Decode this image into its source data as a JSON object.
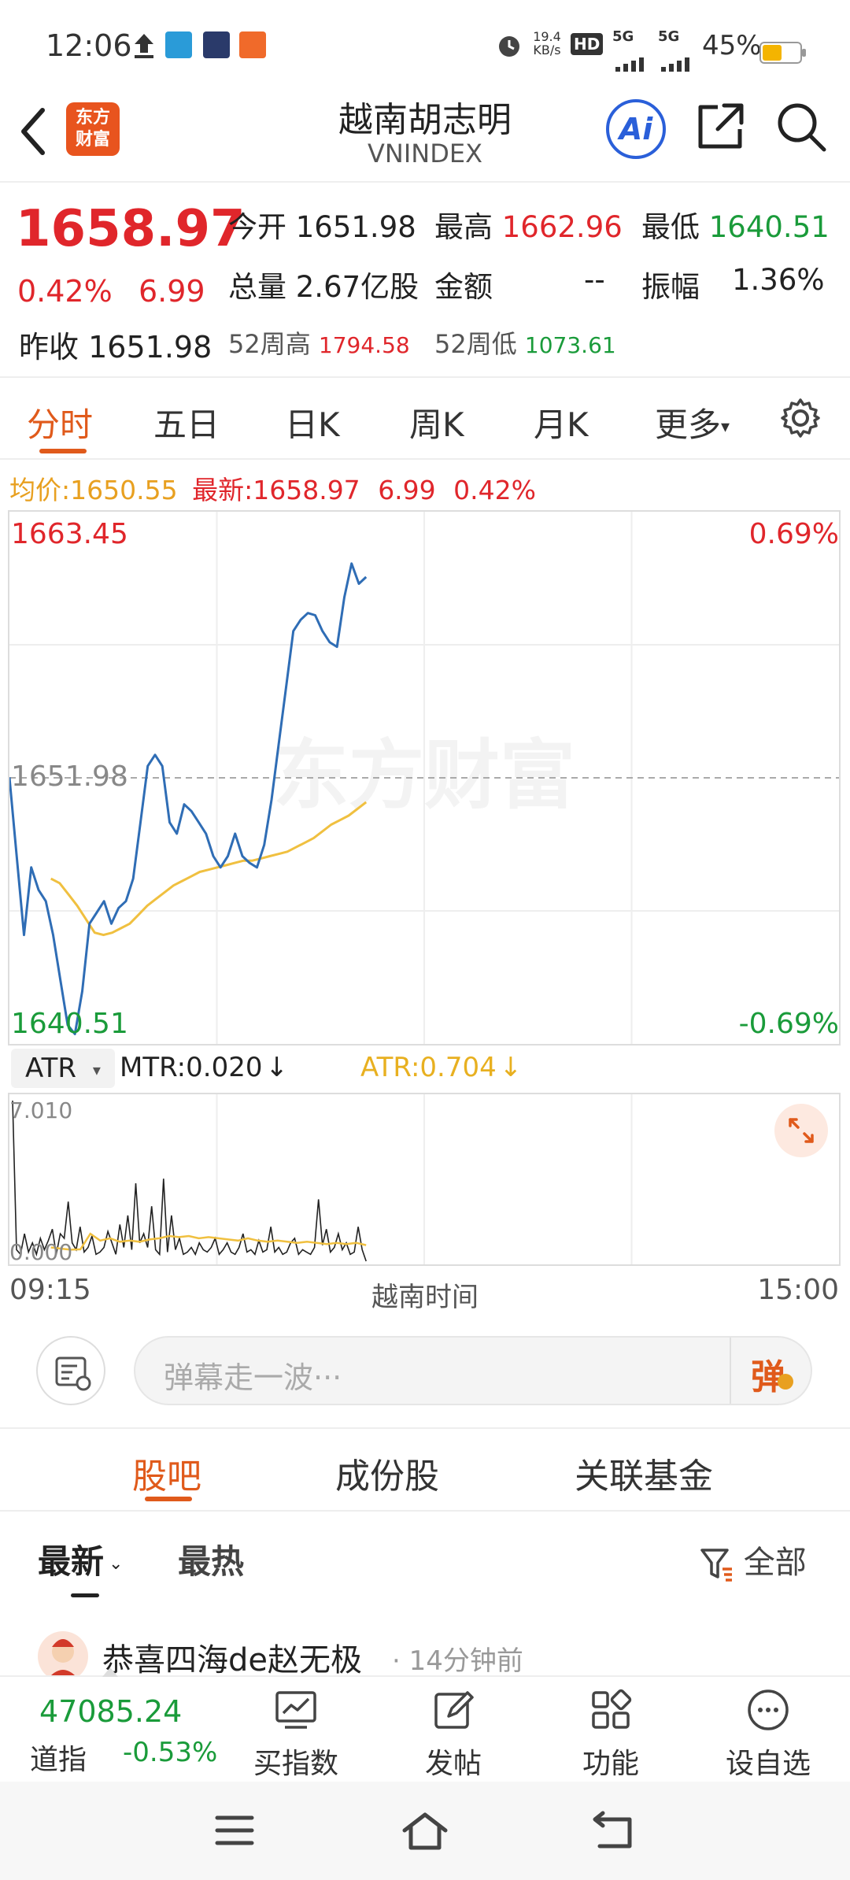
{
  "status": {
    "time": "12:06",
    "net_speed_value": "19.4",
    "net_speed_unit": "KB/s",
    "battery": "45%",
    "signal_1": "5G",
    "signal_2": "5G",
    "hd": "HD"
  },
  "nav": {
    "logo_line1": "东方",
    "logo_line2": "财富",
    "title": "越南胡志明",
    "subtitle": "VNINDEX",
    "ai_label": "Ai"
  },
  "quote": {
    "price": "1658.97",
    "change_pct": "0.42%",
    "change": "6.99",
    "prev_close_label": "昨收",
    "prev_close": "1651.98",
    "open_label": "今开",
    "open": "1651.98",
    "high_label": "最高",
    "high": "1662.96",
    "low_label": "最低",
    "low": "1640.51",
    "volume_label": "总量",
    "volume": "2.67亿股",
    "amount_label": "金额",
    "amount": "--",
    "amplitude_label": "振幅",
    "amplitude": "1.36%",
    "week52_high_label": "52周高",
    "week52_high": "1794.58",
    "week52_low_label": "52周低",
    "week52_low": "1073.61"
  },
  "tabs": [
    "分时",
    "五日",
    "日K",
    "周K",
    "月K",
    "更多"
  ],
  "legend": {
    "avg_label": "均价:",
    "avg": "1650.55",
    "latest_label": "最新:",
    "latest": "1658.97",
    "change": "6.99",
    "change_pct": "0.42%"
  },
  "chart_data": {
    "type": "line",
    "y_axis_left": {
      "top": "1663.45",
      "mid": "1651.98",
      "bottom": "1640.51"
    },
    "y_axis_right": {
      "top": "0.69%",
      "bottom": "-0.69%"
    },
    "ylim": [
      1640.51,
      1663.45
    ],
    "reference": 1651.98,
    "x_labels": {
      "start": "09:15",
      "mid": "越南时间",
      "end": "15:00"
    },
    "watermark": "东方财富",
    "series": [
      {
        "color": "#2f6db5",
        "values": [
          1652.0,
          1648.5,
          1645.0,
          1648.0,
          1647.0,
          1646.5,
          1645.0,
          1643.0,
          1641.0,
          1640.6,
          1642.5,
          1645.5,
          1646.0,
          1646.5,
          1645.5,
          1646.2,
          1646.5,
          1647.5,
          1650.0,
          1652.5,
          1653.0,
          1652.5,
          1650.0,
          1649.5,
          1650.8,
          1650.5,
          1650.0,
          1649.5,
          1648.5,
          1648.0,
          1648.5,
          1649.5,
          1648.5,
          1648.2,
          1648.0,
          1649.0,
          1651.0,
          1653.5,
          1656.0,
          1658.5,
          1659.0,
          1659.3,
          1659.2,
          1658.5,
          1658.0,
          1657.8,
          1660.0,
          1661.5,
          1660.6,
          1660.9
        ]
      },
      {
        "color": "#f0c040",
        "values": [
          1647.5,
          1647.3,
          1646.8,
          1646.3,
          1645.7,
          1645.1,
          1645.0,
          1645.1,
          1645.3,
          1645.5,
          1645.9,
          1646.3,
          1646.6,
          1646.9,
          1647.2,
          1647.4,
          1647.6,
          1647.8,
          1647.9,
          1648.0,
          1648.1,
          1648.2,
          1648.3,
          1648.3,
          1648.4,
          1648.5,
          1648.6,
          1648.7,
          1648.9,
          1649.1,
          1649.3,
          1649.6,
          1649.9,
          1650.1,
          1650.3,
          1650.6,
          1650.9
        ]
      }
    ]
  },
  "indicator": {
    "name": "ATR",
    "mtr_label": "MTR:0.020",
    "atr_label": "ATR:0.704",
    "max": "7.010",
    "min": "0.000"
  },
  "indicator_data": {
    "mtr": [
      7.01,
      0.5,
      0.3,
      1.2,
      0.4,
      0.8,
      0.3,
      1.0,
      0.5,
      0.9,
      1.4,
      0.3,
      1.2,
      1.0,
      2.6,
      0.8,
      0.5,
      1.5,
      0.4,
      0.6,
      1.1,
      0.3,
      0.4,
      0.6,
      1.3,
      0.8,
      0.3,
      1.6,
      0.6,
      2.0,
      0.5,
      3.4,
      0.8,
      1.2,
      0.6,
      2.4,
      0.5,
      0.3,
      3.6,
      0.4,
      2.0,
      0.5,
      1.0,
      0.3,
      0.4,
      0.6,
      0.3,
      0.8,
      0.5,
      0.4,
      0.6,
      1.0,
      0.3,
      0.5,
      0.8,
      0.4,
      0.3,
      0.6,
      1.2,
      0.4,
      0.5,
      0.3,
      0.9,
      0.4,
      0.5,
      1.5,
      0.4,
      0.6,
      0.3,
      0.4,
      0.8,
      1.0,
      0.3,
      0.5,
      0.4,
      0.3,
      0.6,
      2.7,
      0.7,
      1.4,
      0.4,
      0.6,
      1.2,
      0.5,
      0.8,
      0.3,
      0.4,
      1.5,
      0.5,
      0.0
    ],
    "atr": [
      0.6,
      0.55,
      0.5,
      0.52,
      1.2,
      0.9,
      1.0,
      0.85,
      0.9,
      0.85,
      0.95,
      1.0,
      1.1,
      1.05,
      1.1,
      1.0,
      1.05,
      1.0,
      0.95,
      0.9,
      1.0,
      0.9,
      0.85,
      0.9,
      0.85,
      0.8,
      0.85,
      0.8,
      0.75,
      0.8,
      0.75,
      0.8,
      0.7
    ]
  },
  "danmu": {
    "placeholder": "弹幕走一波···",
    "send_label": "弹"
  },
  "content_tabs": [
    "股吧",
    "成份股",
    "关联基金"
  ],
  "filters": {
    "latest": "最新",
    "hot": "最热",
    "all": "全部"
  },
  "post": {
    "author": "恭喜四海de赵无极",
    "time": "14分钟前"
  },
  "bottom": {
    "index_value": "47085.24",
    "index_name": "道指",
    "index_change": "-0.53%",
    "buy_index": "买指数",
    "post": "发帖",
    "functions": "功能",
    "add_watch": "设自选"
  }
}
